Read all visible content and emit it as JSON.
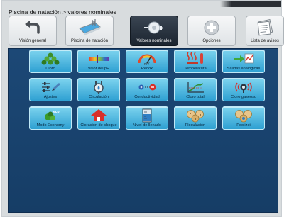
{
  "breadcrumb": "Piscina de natación > valores nominales",
  "toolbar": [
    {
      "label": "Visión general",
      "icon": "back-arrow-icon",
      "active": false
    },
    {
      "label": "Piscina de natación",
      "icon": "pool-icon",
      "active": false
    },
    {
      "label": "Valores nominales",
      "icon": "setpoint-dial-icon",
      "active": true
    },
    {
      "label": "Opciones",
      "icon": "plus-icon",
      "active": false
    },
    {
      "label": "Lista de avisos",
      "icon": "message-list-icon",
      "active": false
    }
  ],
  "tiles": [
    {
      "label": "Cloro",
      "icon": "chlorine-molecule-icon"
    },
    {
      "label": "Valor del pH",
      "icon": "ph-scale-icon"
    },
    {
      "label": "Redox",
      "icon": "redox-gauge-icon"
    },
    {
      "label": "Temperatura",
      "icon": "heater-icon"
    },
    {
      "label": "Salidas analógicas",
      "icon": "analog-output-icon"
    },
    {
      "label": "Ajustes",
      "icon": "settings-sliders-icon"
    },
    {
      "label": "Circulación",
      "icon": "circulation-pump-icon"
    },
    {
      "label": "Conductividad",
      "icon": "conductivity-icon"
    },
    {
      "label": "Cloro total",
      "icon": "total-chlorine-chart-icon"
    },
    {
      "label": "Cloro gaseoso",
      "icon": "chlorine-gas-icon"
    },
    {
      "label": "Modo Economy",
      "icon": "eco-mode-icon"
    },
    {
      "label": "Cloración de choque",
      "icon": "shock-chlorination-icon"
    },
    {
      "label": "Nivel de llenado",
      "icon": "fill-level-icon"
    },
    {
      "label": "Floculación",
      "icon": "flocculation-icon"
    },
    {
      "label": "Poolizei",
      "icon": "poolizei-icon"
    }
  ],
  "colors": {
    "panel": "#1c4876",
    "tile": "#4fb8e2",
    "active_button": "#2a3440"
  }
}
